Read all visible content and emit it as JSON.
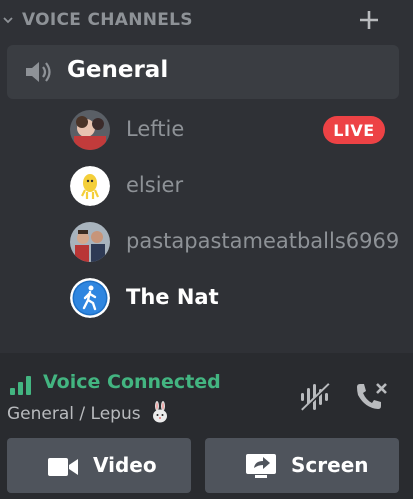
{
  "category": {
    "title": "VOICE CHANNELS",
    "add_icon": "plus-icon",
    "collapse_icon": "chevron-down-icon"
  },
  "channel": {
    "name": "General",
    "icon": "speaker-icon"
  },
  "users": [
    {
      "name": "Leftie",
      "badge": "LIVE",
      "active": false
    },
    {
      "name": "elsier",
      "active": false
    },
    {
      "name": "pastapastameatballs6969",
      "active": false
    },
    {
      "name": "The Nat",
      "active": true
    }
  ],
  "voice_panel": {
    "status": "Voice Connected",
    "location": "General / Lepus",
    "location_emoji": "rabbit-emoji",
    "noise_icon": "noise-suppression-icon",
    "disconnect_icon": "disconnect-call-icon",
    "video_label": "Video",
    "screen_label": "Screen"
  },
  "colors": {
    "background": "#2f3136",
    "panel": "#292b2f",
    "selected_channel": "#3a3d42",
    "connected_green": "#43b581",
    "live_red": "#ed4245",
    "button_gray": "#4f545c",
    "muted_text": "#8e9297"
  }
}
